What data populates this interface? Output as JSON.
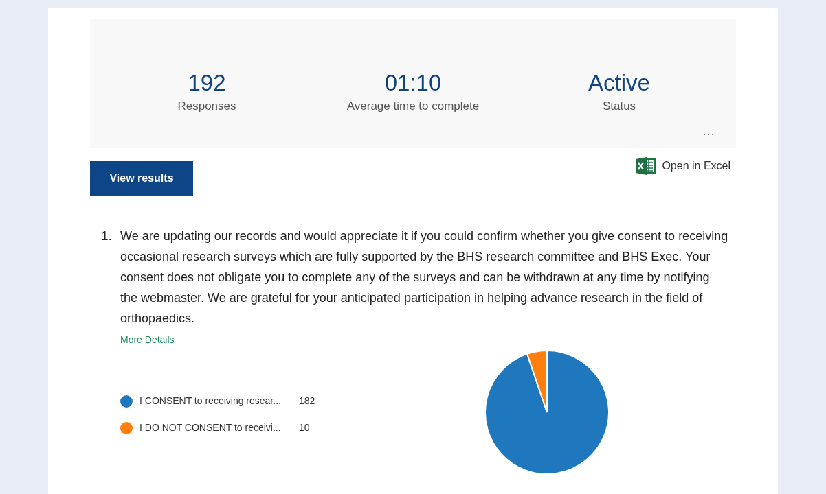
{
  "summary": {
    "stats": [
      {
        "value": "192",
        "label": "Responses"
      },
      {
        "value": "01:10",
        "label": "Average time to complete"
      },
      {
        "value": "Active",
        "label": "Status"
      }
    ],
    "more": "..."
  },
  "actions": {
    "view_results": "View results",
    "open_excel": "Open in Excel"
  },
  "question": {
    "number": "1.",
    "text": "We are updating our records and would appreciate it if you could confirm whether you give consent to receiving occasional research surveys which are fully supported by the BHS research committee and BHS Exec. Your consent does not obligate you to complete any of the surveys and can be withdrawn at any time by notifying the webmaster. We are grateful for your anticipated participation in helping advance research in the field of orthopaedics.",
    "more_details": "More Details",
    "chart_data": {
      "type": "pie",
      "categories": [
        "I CONSENT to receiving resear...",
        "I DO NOT CONSENT to receivi..."
      ],
      "values": [
        182,
        10
      ],
      "value_labels": [
        "182",
        "10"
      ],
      "colors": [
        "#1f77be",
        "#ff7f0e"
      ],
      "legend": "left"
    }
  }
}
